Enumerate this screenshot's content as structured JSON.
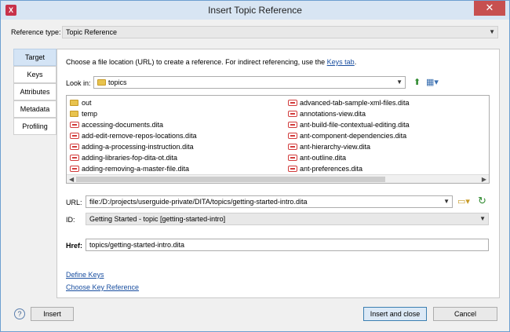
{
  "window": {
    "title": "Insert Topic Reference",
    "close_glyph": "✕",
    "app_glyph": "X"
  },
  "reference_type": {
    "label": "Reference type:",
    "value": "Topic Reference"
  },
  "tabs": [
    "Target",
    "Keys",
    "Attributes",
    "Metadata",
    "Profiling"
  ],
  "instructions": {
    "text": "Choose a file location (URL) to create a reference. For indirect referencing, use the ",
    "link": "Keys tab",
    "suffix": "."
  },
  "look_in": {
    "label": "Look in:",
    "value": "topics"
  },
  "files": {
    "col1": [
      {
        "name": "out",
        "type": "folder"
      },
      {
        "name": "temp",
        "type": "folder"
      },
      {
        "name": "accessing-documents.dita",
        "type": "dita"
      },
      {
        "name": "add-edit-remove-repos-locations.dita",
        "type": "dita"
      },
      {
        "name": "adding-a-processing-instruction.dita",
        "type": "dita"
      },
      {
        "name": "adding-libraries-fop-dita-ot.dita",
        "type": "dita"
      },
      {
        "name": "adding-removing-a-master-file.dita",
        "type": "dita"
      }
    ],
    "col2": [
      {
        "name": "advanced-tab-sample-xml-files.dita",
        "type": "dita"
      },
      {
        "name": "annotations-view.dita",
        "type": "dita"
      },
      {
        "name": "ant-build-file-contextual-editing.dita",
        "type": "dita"
      },
      {
        "name": "ant-component-dependencies.dita",
        "type": "dita"
      },
      {
        "name": "ant-hierarchy-view.dita",
        "type": "dita"
      },
      {
        "name": "ant-outline.dita",
        "type": "dita"
      },
      {
        "name": "ant-preferences.dita",
        "type": "dita"
      }
    ]
  },
  "url": {
    "label": "URL:",
    "value": "file:/D:/projects/userguide-private/DITA/topics/getting-started-intro.dita"
  },
  "id": {
    "label": "ID:",
    "value": "Getting Started - topic [getting-started-intro]"
  },
  "href": {
    "label": "Href:",
    "value": "topics/getting-started-intro.dita"
  },
  "links": {
    "define_keys": "Define Keys",
    "choose_key_reference": "Choose Key Reference"
  },
  "buttons": {
    "help": "?",
    "insert": "Insert",
    "insert_and_close": "Insert and close",
    "cancel": "Cancel"
  }
}
